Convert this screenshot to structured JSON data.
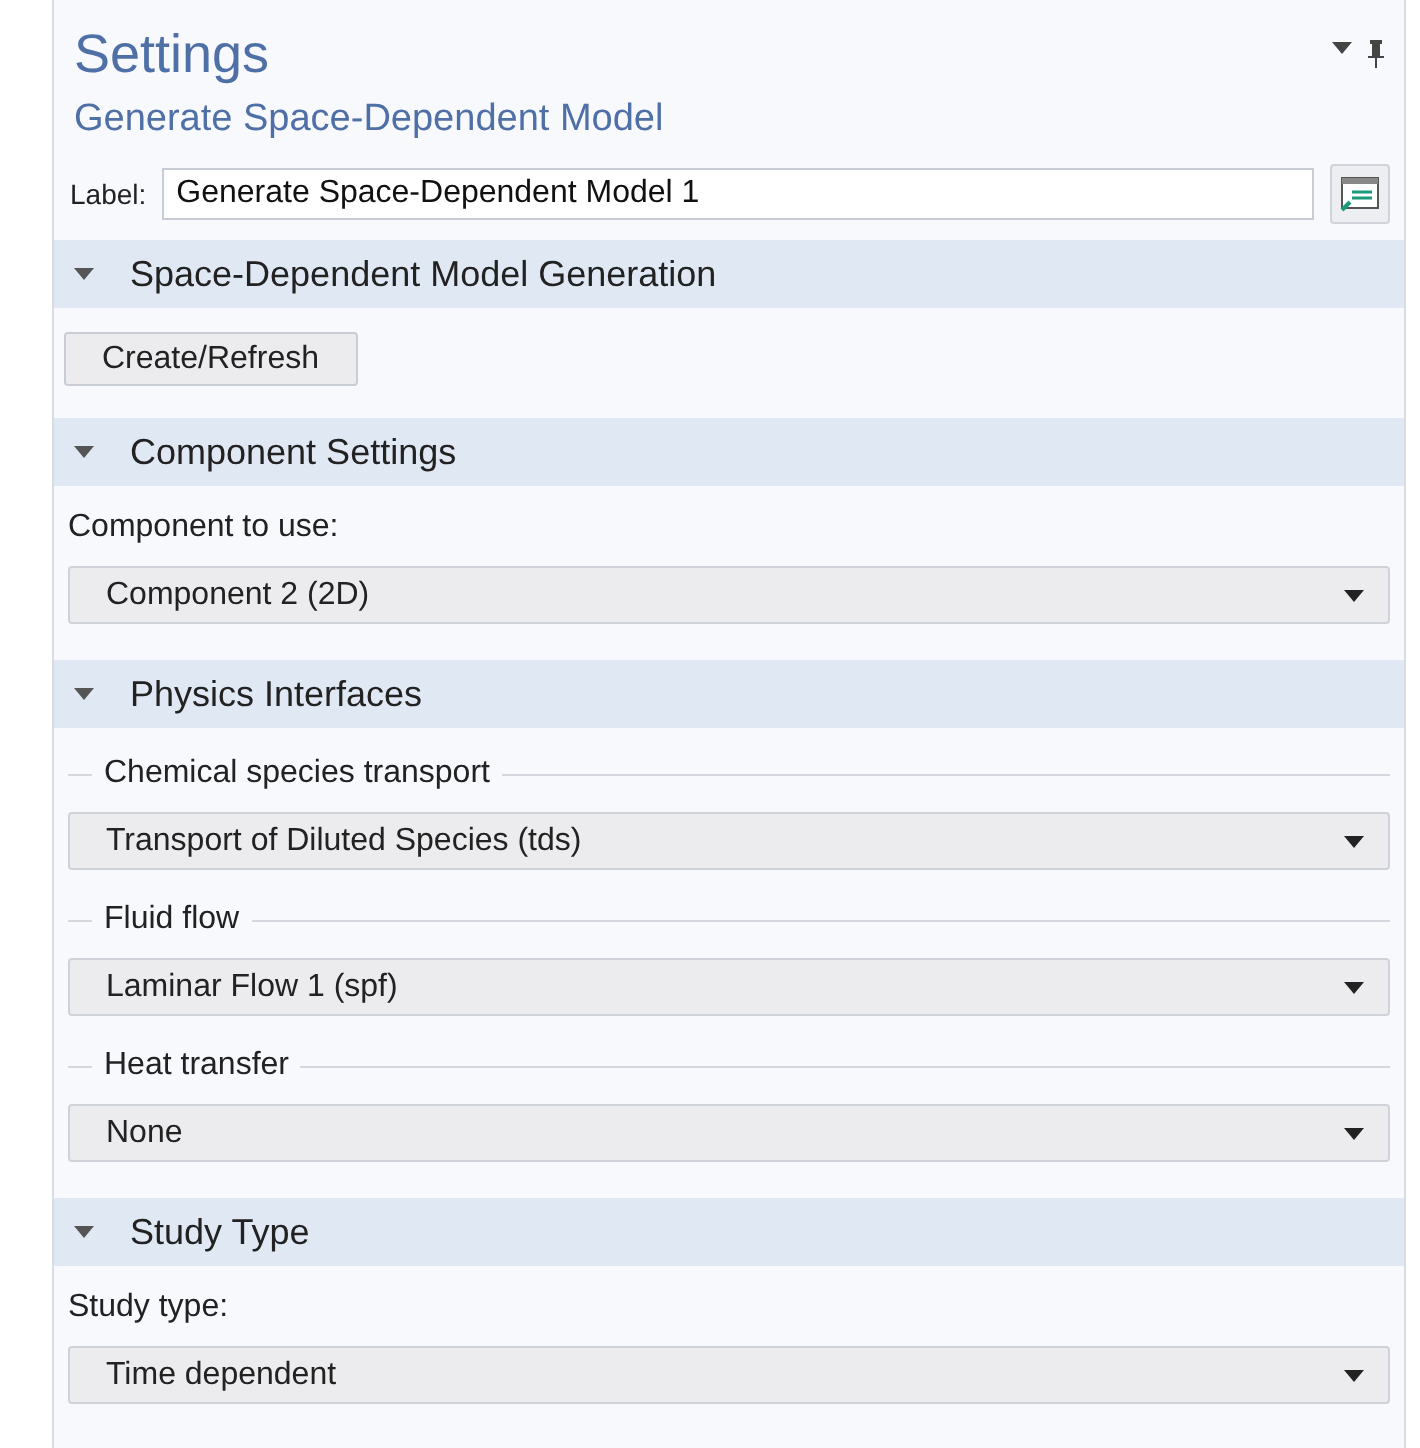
{
  "header": {
    "title": "Settings",
    "subtitle": "Generate Space-Dependent Model"
  },
  "label_field": {
    "label": "Label:",
    "value": "Generate Space-Dependent Model 1"
  },
  "sections": [
    {
      "title": "Space-Dependent Model Generation",
      "expanded": true,
      "items": [
        {
          "kind": "button",
          "text": "Create/Refresh"
        }
      ]
    },
    {
      "title": "Component Settings",
      "expanded": true,
      "items": [
        {
          "kind": "label",
          "text": "Component to use:"
        },
        {
          "kind": "dropdown",
          "text": "Component 2 (2D)"
        }
      ]
    },
    {
      "title": "Physics Interfaces",
      "expanded": true,
      "items": [
        {
          "kind": "group",
          "text": "Chemical species transport"
        },
        {
          "kind": "dropdown",
          "text": "Transport of Diluted Species (tds)"
        },
        {
          "kind": "group",
          "text": "Fluid flow"
        },
        {
          "kind": "dropdown",
          "text": "Laminar Flow 1 (spf)"
        },
        {
          "kind": "group",
          "text": "Heat transfer"
        },
        {
          "kind": "dropdown",
          "text": "None"
        }
      ]
    },
    {
      "title": "Study Type",
      "expanded": true,
      "items": [
        {
          "kind": "label",
          "text": "Study type:"
        },
        {
          "kind": "dropdown",
          "text": "Time dependent"
        }
      ]
    }
  ]
}
